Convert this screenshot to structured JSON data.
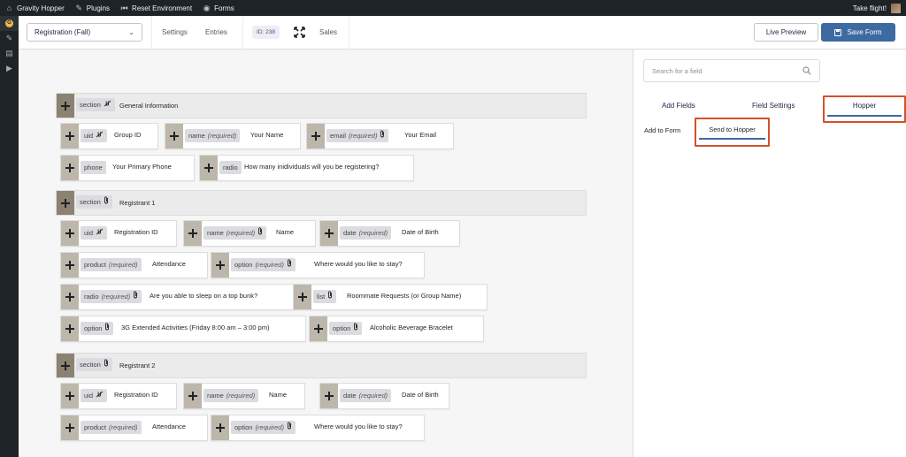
{
  "admin_bar": {
    "site": "Gravity Hopper",
    "plugins": "Plugins",
    "reset": "Reset Environment",
    "forms": "Forms",
    "greeting": "Take flight!"
  },
  "toolbar": {
    "form_selector": "Registration (Fall)",
    "settings": "Settings",
    "entries": "Entries",
    "id_badge": "ID: 238",
    "sales": "Sales",
    "live_preview": "Live Preview",
    "save_form": "Save Form"
  },
  "panel": {
    "search_placeholder": "Search for a field",
    "tabs": [
      "Add Fields",
      "Field Settings",
      "Hopper"
    ],
    "subtabs": [
      "Add to Form",
      "Send to Hopper"
    ],
    "active_tab": "Hopper",
    "active_subtab": "Send to Hopper"
  },
  "required_label": "(required)",
  "sections": [
    {
      "type": "section",
      "icon": "no-paperclip-icon",
      "label": "General Information",
      "rows": [
        [
          {
            "type": "uid",
            "icon": "no-paperclip-icon",
            "label": "Group ID"
          },
          {
            "type": "name",
            "required": true,
            "label": "Your Name"
          },
          {
            "type": "email",
            "required": true,
            "icon": "paperclip-icon",
            "label": "Your Email"
          }
        ],
        [
          {
            "type": "phone",
            "label": "Your Primary Phone"
          },
          {
            "type": "radio",
            "label": "How many inidividuals will you be registering?"
          }
        ]
      ]
    },
    {
      "type": "section",
      "icon": "paperclip-icon",
      "label": "Registrant 1",
      "rows": [
        [
          {
            "type": "uid",
            "icon": "no-paperclip-icon",
            "label": "Registration ID"
          },
          {
            "type": "name",
            "required": true,
            "icon": "paperclip-icon",
            "label": "Name"
          },
          {
            "type": "date",
            "required": true,
            "label": "Date of Birth"
          }
        ],
        [
          {
            "type": "product",
            "required": true,
            "label": "Attendance"
          },
          {
            "type": "option",
            "required": true,
            "icon": "paperclip-icon",
            "label": "Where would you like to stay?"
          }
        ],
        [
          {
            "type": "radio",
            "required": true,
            "icon": "paperclip-icon",
            "label": "Are you able to sleep on a top bunk?"
          },
          {
            "type": "list",
            "icon": "paperclip-icon",
            "label": "Roommate Requests (or Group Name)"
          }
        ],
        [
          {
            "type": "option",
            "icon": "paperclip-icon",
            "label": "3G Extended Activities (Friday 8:00 am – 3:00 pm)"
          },
          {
            "type": "option",
            "icon": "paperclip-icon",
            "label": "Alcoholic Beverage Bracelet"
          }
        ]
      ]
    },
    {
      "type": "section",
      "icon": "paperclip-icon",
      "label": "Registrant 2",
      "rows": [
        [
          {
            "type": "uid",
            "icon": "no-paperclip-icon",
            "label": "Registration ID"
          },
          {
            "type": "name",
            "required": true,
            "label": "Name"
          },
          {
            "type": "date",
            "required": true,
            "label": "Date of Birth"
          }
        ],
        [
          {
            "type": "product",
            "required": true,
            "label": "Attendance"
          },
          {
            "type": "option",
            "required": true,
            "icon": "paperclip-icon",
            "label": "Where would you like to stay?"
          }
        ]
      ]
    }
  ]
}
